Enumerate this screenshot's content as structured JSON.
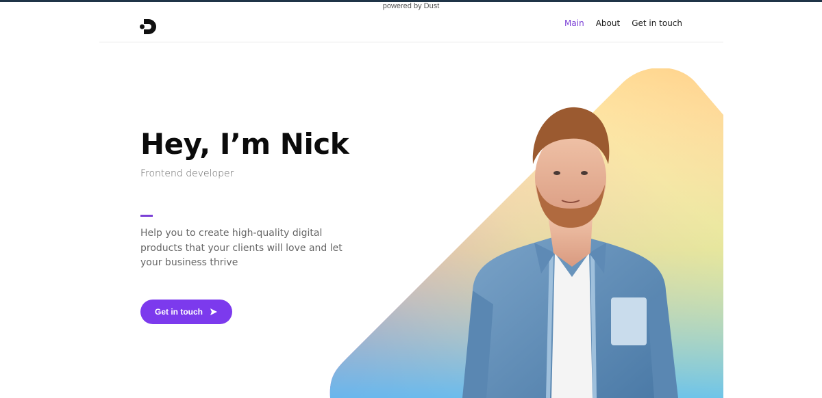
{
  "powered_by": "powered by Dust",
  "nav": {
    "main": "Main",
    "about": "About",
    "contact": "Get in touch"
  },
  "hero": {
    "title": "Hey, I’m Nick",
    "subtitle": "Frontend developer",
    "description": "Help you to create high-quality digital products that your clients will love and let your business thrive",
    "cta_label": "Get in touch"
  },
  "colors": {
    "accent": "#7b40d6",
    "button": "#7c3aed",
    "top_strip": "#1f3447"
  },
  "icons": {
    "logo": "dust-logo",
    "cta": "send-arrow-icon"
  }
}
